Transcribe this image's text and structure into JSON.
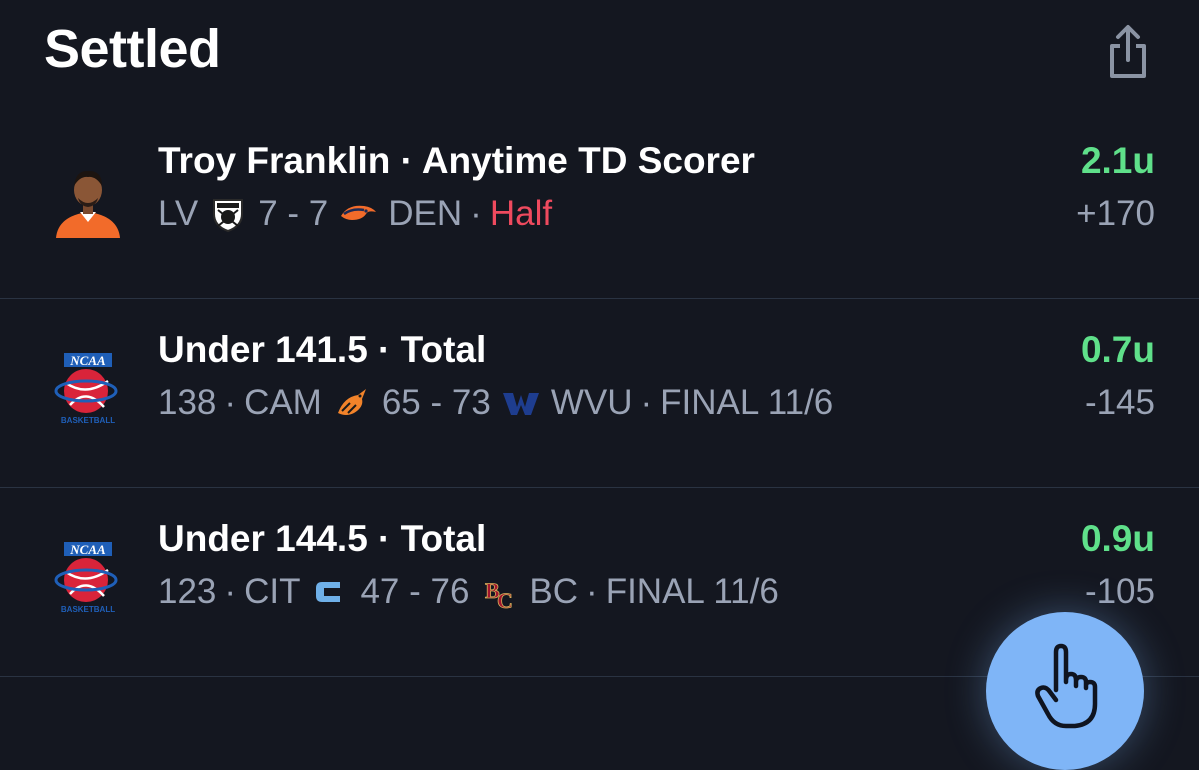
{
  "header": {
    "title": "Settled"
  },
  "bets": [
    {
      "logo": "player-headshot",
      "title": "Troy Franklin · Anytime TD Scorer",
      "prefix": "",
      "away_abbr": "LV",
      "away_icon": "raiders-logo",
      "score": "7 - 7",
      "home_icon": "broncos-logo",
      "home_abbr": "DEN",
      "status": "Half",
      "units": "2.1u",
      "odds": "+170"
    },
    {
      "logo": "ncaa-basketball-logo",
      "title": "Under 141.5 · Total",
      "prefix": "138",
      "away_abbr": "CAM",
      "away_icon": "campbell-logo",
      "score": "65 - 73",
      "home_icon": "wvu-logo",
      "home_abbr": "WVU",
      "status": "FINAL 11/6",
      "units": "0.7u",
      "odds": "-145"
    },
    {
      "logo": "ncaa-basketball-logo",
      "title": "Under 144.5 · Total",
      "prefix": "123",
      "away_abbr": "CIT",
      "away_icon": "citadel-logo",
      "score": "47 - 76",
      "home_icon": "boston-college-logo",
      "home_abbr": "BC",
      "status": "FINAL 11/6",
      "units": "0.9u",
      "odds": "-105"
    }
  ],
  "colors": {
    "background": "#141720",
    "win_green": "#5fe08a",
    "muted": "#9aa3b5",
    "live_red": "#ef4a5e",
    "fab_blue": "#7fb5f7"
  },
  "fab": {
    "icon": "pointing-hand-icon"
  }
}
